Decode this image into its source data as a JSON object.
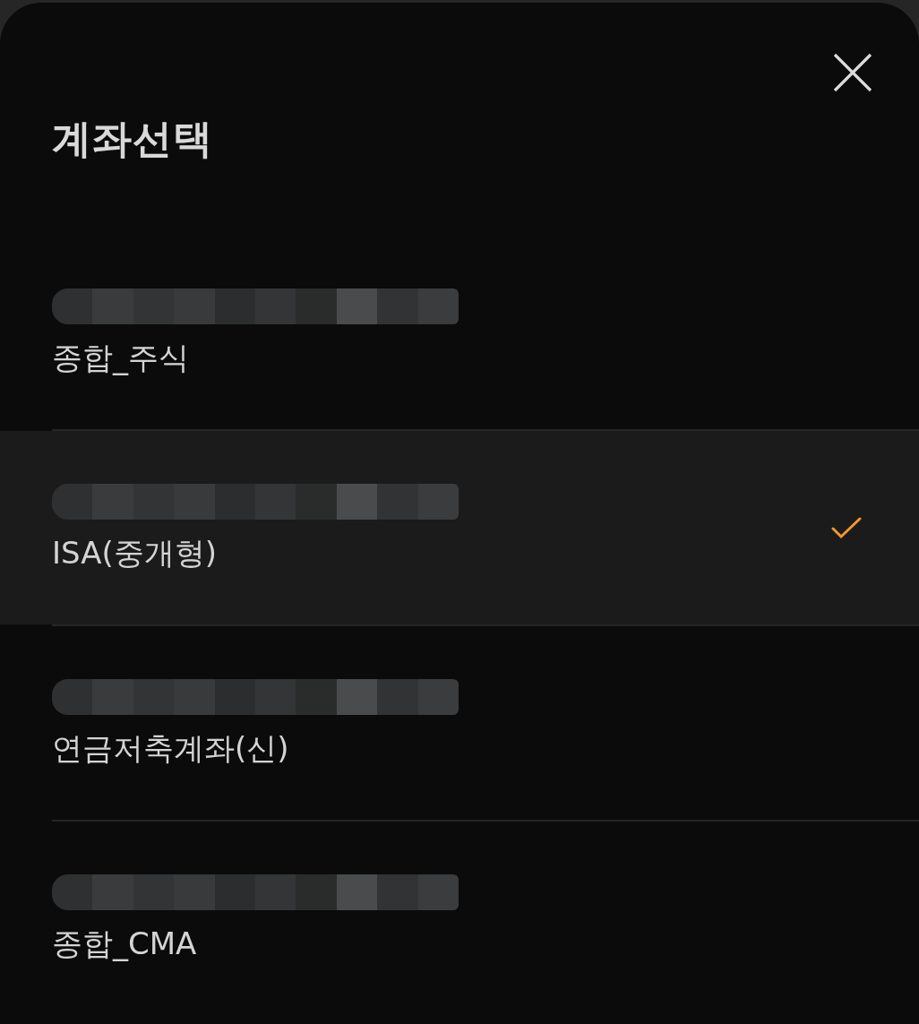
{
  "sheet": {
    "title": "계좌선택"
  },
  "accounts": [
    {
      "name": "종합_주식",
      "selected": false
    },
    {
      "name": "ISA(중개형)",
      "selected": true
    },
    {
      "name": "연금저축계좌(신)",
      "selected": false
    },
    {
      "name": "종합_CMA",
      "selected": false
    }
  ]
}
